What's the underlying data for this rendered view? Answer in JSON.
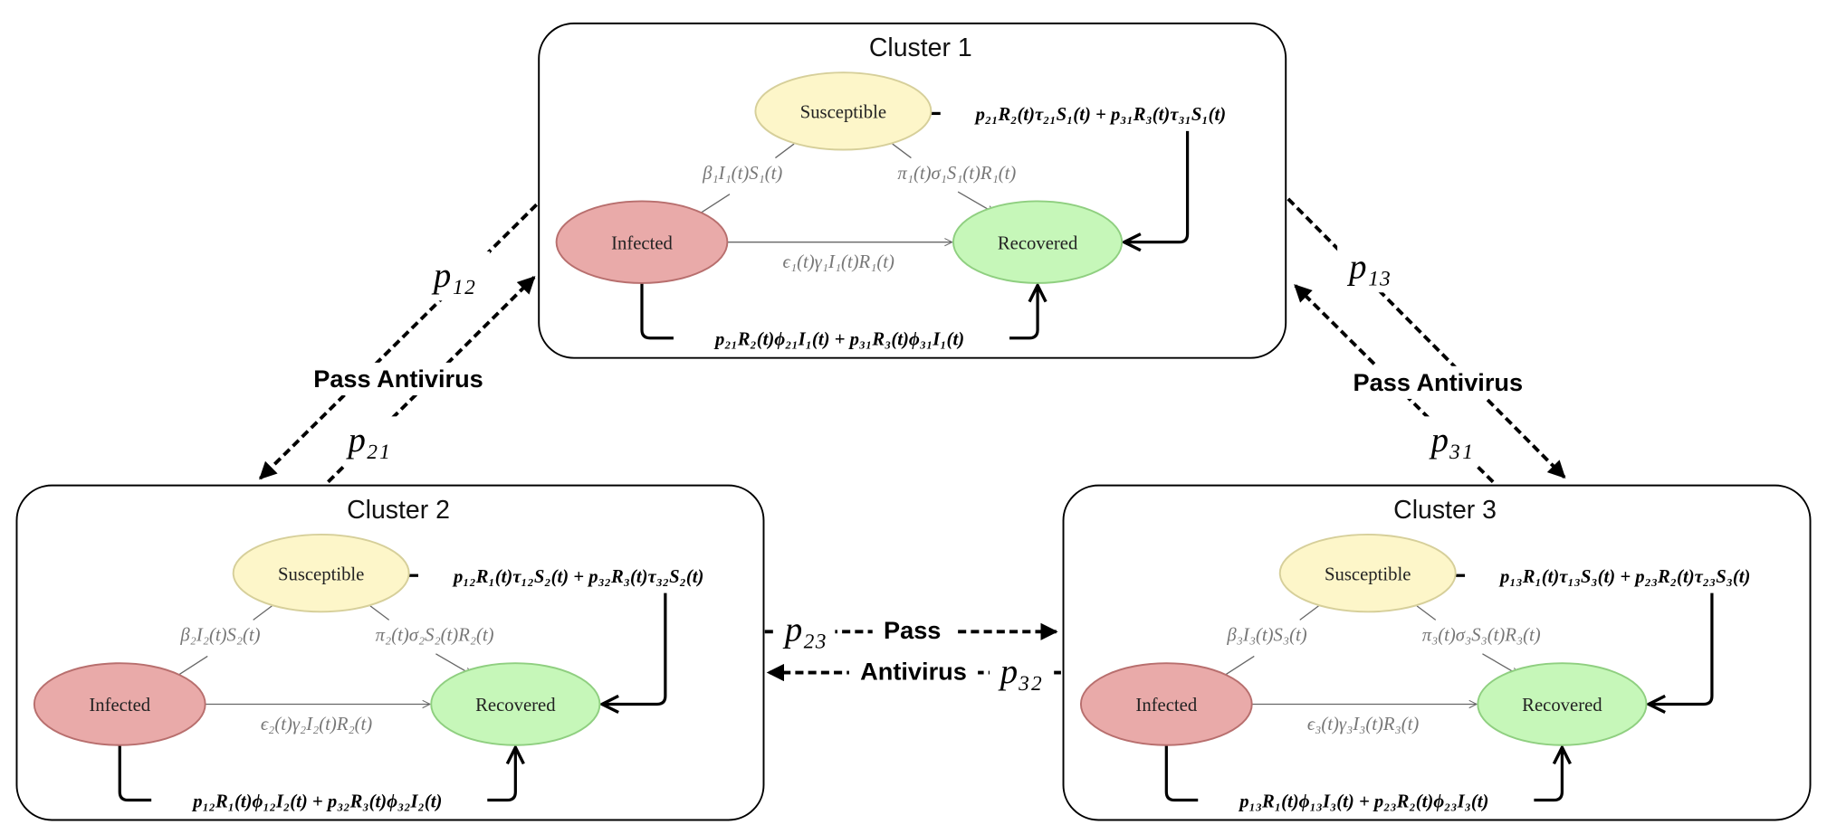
{
  "clusters": [
    {
      "title": "Cluster 1",
      "states": {
        "susceptible": "Susceptible",
        "infected": "Infected",
        "recovered": "Recovered"
      },
      "rates": {
        "s_to_i": "β₁I₁(t)S₁(t)",
        "s_to_r": "π₁(t)σ₁S₁(t)R₁(t)",
        "i_to_r": "ϵ₁(t)γ₁I₁(t)R₁(t)"
      },
      "flows": {
        "top": "p₂₁R₂(t)τ₂₁S₁(t) + p₃₁R₃(t)τ₃₁S₁(t)",
        "bottom": "p₂₁R₂(t)ϕ₂₁I₁(t) + p₃₁R₃(t)ϕ₃₁I₁(t)"
      }
    },
    {
      "title": "Cluster 2",
      "states": {
        "susceptible": "Susceptible",
        "infected": "Infected",
        "recovered": "Recovered"
      },
      "rates": {
        "s_to_i": "β₂I₂(t)S₂(t)",
        "s_to_r": "π₂(t)σ₂S₂(t)R₂(t)",
        "i_to_r": "ϵ₂(t)γ₂I₂(t)R₂(t)"
      },
      "flows": {
        "top": "p₁₂R₁(t)τ₁₂S₂(t) + p₃₂R₃(t)τ₃₂S₂(t)",
        "bottom": "p₁₂R₁(t)ϕ₁₂I₂(t) + p₃₂R₃(t)ϕ₃₂I₂(t)"
      }
    },
    {
      "title": "Cluster 3",
      "states": {
        "susceptible": "Susceptible",
        "infected": "Infected",
        "recovered": "Recovered"
      },
      "rates": {
        "s_to_i": "β₃I₃(t)S₃(t)",
        "s_to_r": "π₃(t)σ₃S₃(t)R₃(t)",
        "i_to_r": "ϵ₃(t)γ₃I₃(t)R₃(t)"
      },
      "flows": {
        "top": "p₁₃R₁(t)τ₁₃S₃(t) + p₂₃R₂(t)τ₂₃S₃(t)",
        "bottom": "p₁₃R₁(t)ϕ₁₃I₃(t) + p₂₃R₂(t)ϕ₂₃I₃(t)"
      }
    }
  ],
  "links": {
    "p12": "p₁₂",
    "p21": "p₂₁",
    "p13": "p₁₃",
    "p31": "p₃₁",
    "p23": "p₂₃",
    "p32": "p₃₂",
    "pass_antivirus_left": "Pass Antivirus",
    "pass_antivirus_right": "Pass Antivirus",
    "pass": "Pass",
    "antivirus": "Antivirus"
  },
  "colors": {
    "susceptible_fill": "#fdf6c9",
    "susceptible_stroke": "#d6cf9a",
    "infected_fill": "#e9aaa9",
    "infected_stroke": "#b86f6e",
    "recovered_fill": "#c6f7b9",
    "recovered_stroke": "#8fcf80"
  }
}
